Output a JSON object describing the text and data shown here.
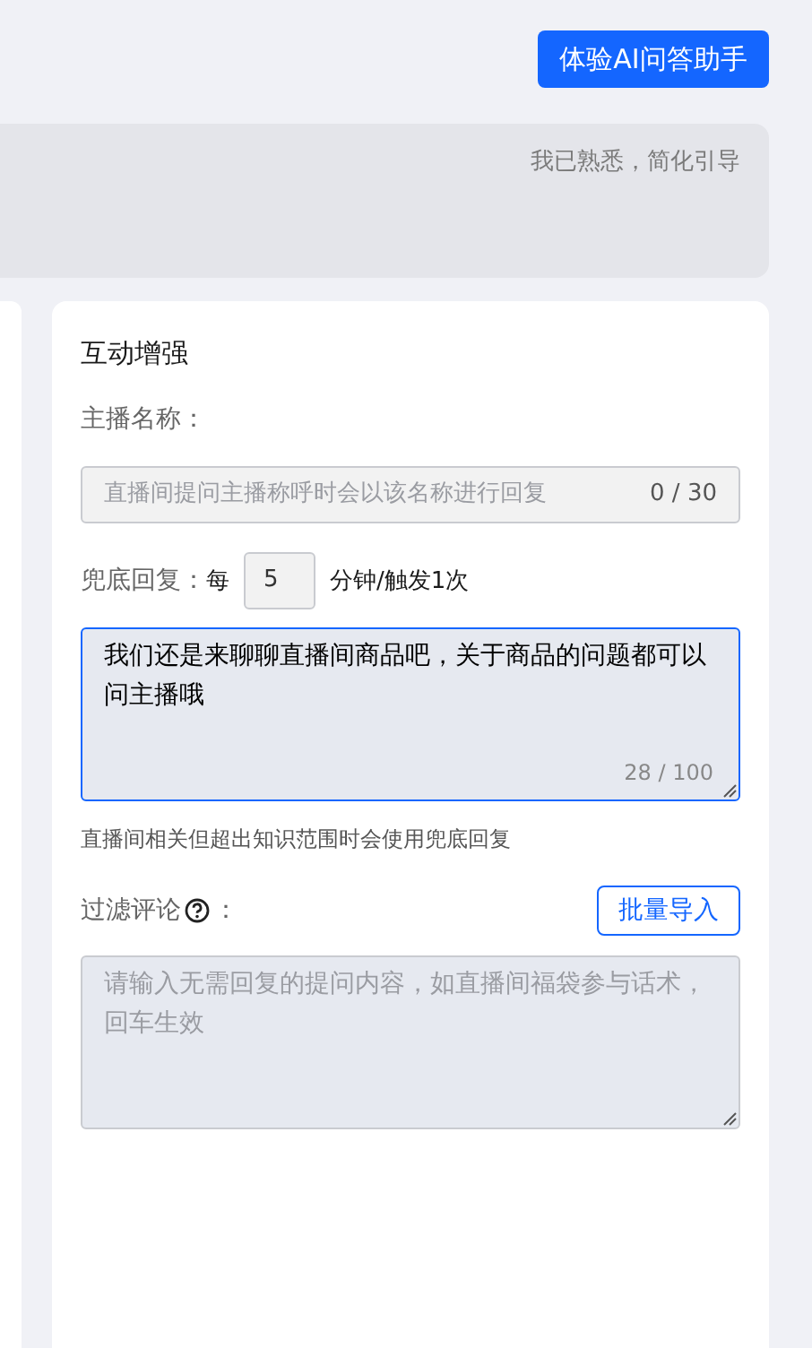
{
  "header": {
    "button": "体验AI问答助手"
  },
  "banner": {
    "link": "我已熟悉，简化引导"
  },
  "card": {
    "title": "互动增强",
    "anchor_name": {
      "label": "主播名称：",
      "placeholder": "直播间提问主播称呼时会以该名称进行回复",
      "counter": "0 / 30"
    },
    "fallback": {
      "label": "兜底回复：",
      "prefix": "每",
      "interval": "5",
      "suffix": "分钟/触发1次",
      "value": "我们还是来聊聊直播间商品吧，关于商品的问题都可以问主播哦",
      "counter": "28 / 100",
      "focused": true,
      "hint": "直播间相关但超出知识范围时会使用兜底回复"
    },
    "filter": {
      "label": "过滤评论",
      "colon": "：",
      "button": "批量导入",
      "placeholder": "请输入无需回复的提问内容，如直播间福袋参与话术，回车生效"
    }
  }
}
